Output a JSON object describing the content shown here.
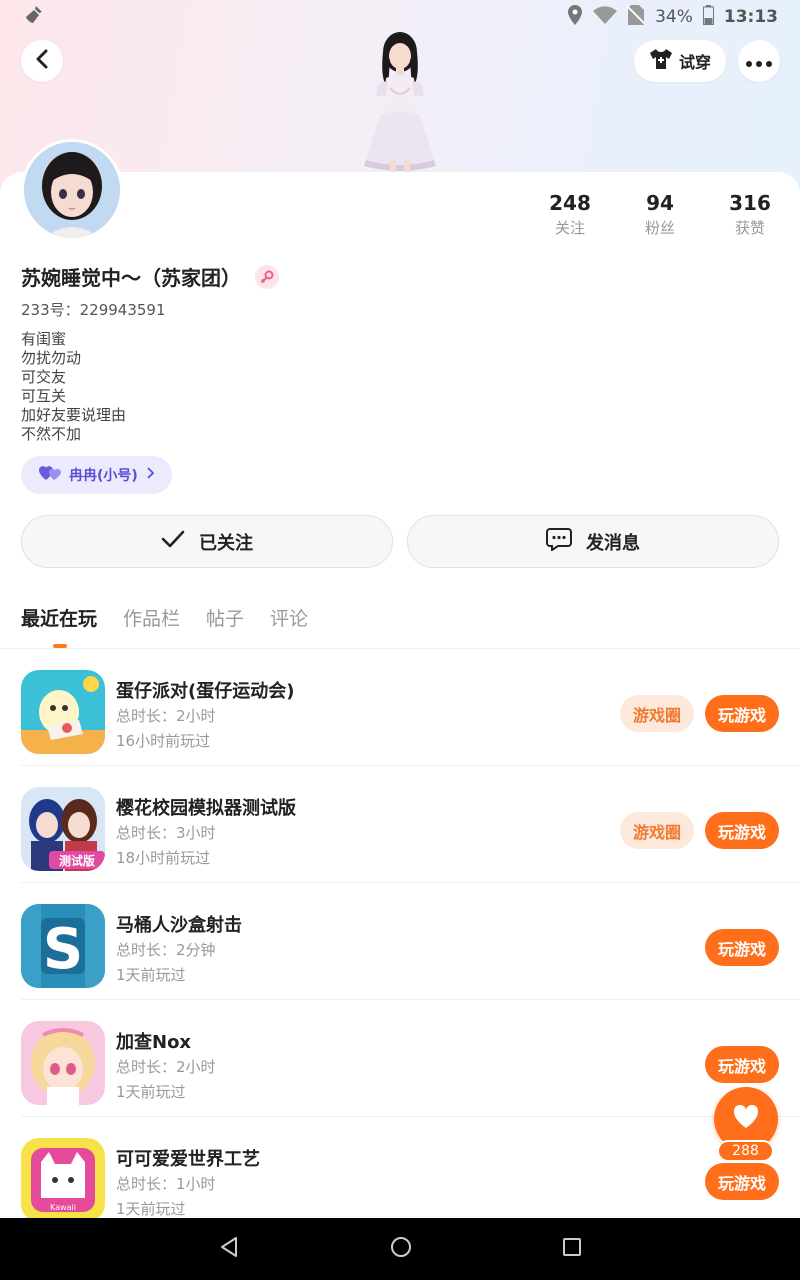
{
  "status_bar": {
    "battery": "34%",
    "time": "13:13"
  },
  "header": {
    "tryon_label": "试穿"
  },
  "profile": {
    "username": "苏婉睡觉中～（苏家团）",
    "user_id": "233号：229943591",
    "bio": [
      "有闺蜜",
      "勿扰勿动",
      "可交友",
      "可互关",
      "加好友要说理由",
      "不然不加"
    ],
    "alt_account": "冉冉(小号)",
    "stats": [
      {
        "value": "248",
        "label": "关注"
      },
      {
        "value": "94",
        "label": "粉丝"
      },
      {
        "value": "316",
        "label": "获赞"
      }
    ]
  },
  "actions": {
    "follow_label": "已关注",
    "message_label": "发消息"
  },
  "tabs": [
    "最近在玩",
    "作品栏",
    "帖子",
    "评论"
  ],
  "games": [
    {
      "title": "蛋仔派对(蛋仔运动会)",
      "duration": "总时长：2小时",
      "last_played": "16小时前玩过",
      "circle_label": "游戏圈",
      "play_label": "玩游戏"
    },
    {
      "title": "樱花校园模拟器测试版",
      "duration": "总时长：3小时",
      "last_played": "18小时前玩过",
      "circle_label": "游戏圈",
      "play_label": "玩游戏",
      "icon_text": "测试版"
    },
    {
      "title": "马桶人沙盒射击",
      "duration": "总时长：2分钟",
      "last_played": "1天前玩过",
      "play_label": "玩游戏",
      "icon_text": "S"
    },
    {
      "title": "加查Nox",
      "duration": "总时长：2小时",
      "last_played": "1天前玩过",
      "play_label": "玩游戏"
    },
    {
      "title": "可可爱爱世界工艺",
      "duration": "总时长：1小时",
      "last_played": "1天前玩过",
      "play_label": "玩游戏",
      "icon_text": "Kawaii"
    }
  ],
  "like_fab": {
    "count": "288"
  },
  "colors": {
    "accent": "#ff6e1a",
    "accent_soft": "#fde8dc",
    "alt_account": "#5b4fd8"
  }
}
